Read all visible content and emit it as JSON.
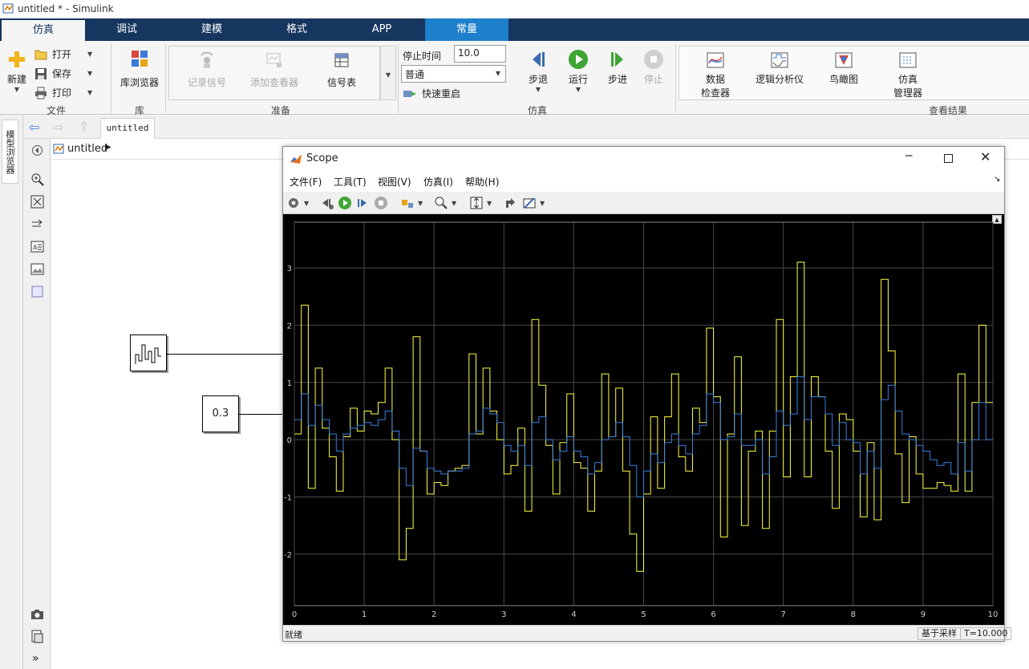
{
  "window": {
    "title": "untitled * - Simulink"
  },
  "tabs": [
    {
      "label": "仿真",
      "active": true
    },
    {
      "label": "调试"
    },
    {
      "label": "建模"
    },
    {
      "label": "格式"
    },
    {
      "label": "APP"
    },
    {
      "label": "常量",
      "contextual": true
    }
  ],
  "ribbon": {
    "file": {
      "new_label": "新建",
      "open_label": "打开",
      "save_label": "保存",
      "print_label": "打印",
      "group_label": "文件"
    },
    "library": {
      "browser_label": "库浏览器",
      "group_label": "库"
    },
    "prepare": {
      "record_label": "记录信号",
      "add_viewer_label": "添加查看器",
      "signal_table_label": "信号表",
      "group_label": "准备"
    },
    "simulate": {
      "stop_time_label": "停止时间",
      "stop_time_value": "10.0",
      "mode_value": "普通",
      "fast_restart_label": "快速重启",
      "step_back_label": "步退",
      "run_label": "运行",
      "step_forward_label": "步进",
      "stop_label": "停止",
      "group_label": "仿真"
    },
    "review": {
      "data_inspector_label_1": "数据",
      "data_inspector_label_2": "检查器",
      "logic_analyzer_label": "逻辑分析仪",
      "birdseye_label": "鸟瞰图",
      "sim_manager_label_1": "仿真",
      "sim_manager_label_2": "管理器",
      "group_label": "查看结果"
    }
  },
  "nav": {
    "model_tab": "untitled",
    "breadcrumb": "untitled",
    "side_tab": "模型浏览器"
  },
  "model": {
    "constant_value": "0.3"
  },
  "scope": {
    "title": "Scope",
    "menu": [
      "文件(F)",
      "工具(T)",
      "视图(V)",
      "仿真(I)",
      "帮助(H)"
    ],
    "status_left": "就绪",
    "status_mode": "基于采样",
    "status_time": "T=10.000"
  },
  "colors": {
    "tab_bar": "#16355f",
    "contextual_tab": "#1e7fcb",
    "trace_yellow": "#ffff40",
    "trace_blue": "#3a7fe0",
    "plot_bg": "#000000",
    "grid": "#4a4a4a"
  },
  "chart_data": {
    "type": "line",
    "xlim": [
      0,
      10
    ],
    "ylim": [
      -2.9,
      3.8
    ],
    "x_ticks": [
      "0",
      "1",
      "2",
      "3",
      "4",
      "5",
      "6",
      "7",
      "8",
      "9",
      "10"
    ],
    "y_ticks": [
      "-2",
      "-1",
      "0",
      "1",
      "2",
      "3"
    ],
    "grid": true,
    "step": true,
    "series": [
      {
        "color": "yellow",
        "x": [
          0,
          0.1,
          0.2,
          0.3,
          0.4,
          0.5,
          0.6,
          0.7,
          0.8,
          0.9,
          1.0,
          1.1,
          1.2,
          1.3,
          1.4,
          1.5,
          1.6,
          1.7,
          1.8,
          1.9,
          2.0,
          2.1,
          2.2,
          2.3,
          2.4,
          2.5,
          2.6,
          2.7,
          2.8,
          2.9,
          3.0,
          3.1,
          3.2,
          3.3,
          3.4,
          3.5,
          3.6,
          3.7,
          3.8,
          3.9,
          4.0,
          4.1,
          4.2,
          4.3,
          4.4,
          4.5,
          4.6,
          4.7,
          4.8,
          4.9,
          5.0,
          5.1,
          5.2,
          5.3,
          5.4,
          5.5,
          5.6,
          5.7,
          5.8,
          5.9,
          6.0,
          6.1,
          6.2,
          6.3,
          6.4,
          6.5,
          6.6,
          6.7,
          6.8,
          6.9,
          7.0,
          7.1,
          7.2,
          7.3,
          7.4,
          7.5,
          7.6,
          7.7,
          7.8,
          7.9,
          8.0,
          8.1,
          8.2,
          8.3,
          8.4,
          8.5,
          8.6,
          8.7,
          8.8,
          8.9,
          9.0,
          9.1,
          9.2,
          9.3,
          9.4,
          9.5,
          9.6,
          9.7,
          9.8,
          9.9
        ],
        "y": [
          0.1,
          2.35,
          -0.85,
          1.25,
          0.2,
          -0.3,
          -0.9,
          0.05,
          0.55,
          0.15,
          0.5,
          0.45,
          0.65,
          1.25,
          0.0,
          -2.1,
          -1.55,
          1.8,
          -0.2,
          -0.95,
          -0.75,
          -0.8,
          -0.55,
          -0.5,
          -0.45,
          1.5,
          0.1,
          1.25,
          0.5,
          0.0,
          -0.6,
          -0.45,
          0.2,
          -1.25,
          2.1,
          0.95,
          -0.1,
          -0.95,
          -0.05,
          0.8,
          -0.4,
          -0.5,
          -1.25,
          -0.55,
          1.15,
          0.05,
          0.9,
          -0.55,
          -1.65,
          -2.3,
          -0.95,
          0.4,
          -0.85,
          0.4,
          1.15,
          -0.3,
          -0.55,
          0.55,
          0.3,
          1.95,
          0.75,
          -1.7,
          0.1,
          1.45,
          -1.5,
          -0.2,
          0.15,
          -1.55,
          0.15,
          2.1,
          -0.65,
          1.1,
          3.1,
          -0.65,
          1.1,
          0.75,
          -0.2,
          -1.2,
          0.45,
          0.35,
          -0.2,
          -1.35,
          -0.05,
          -1.4,
          2.8,
          1.55,
          -0.25,
          -1.1,
          0.05,
          -0.6,
          -0.85,
          -0.85,
          -0.75,
          -0.8,
          -0.9,
          1.15,
          -0.9,
          0.65,
          2.0,
          0.65
        ]
      },
      {
        "color": "blue",
        "x": [
          0,
          0.1,
          0.2,
          0.3,
          0.4,
          0.5,
          0.6,
          0.7,
          0.8,
          0.9,
          1.0,
          1.1,
          1.2,
          1.3,
          1.4,
          1.5,
          1.6,
          1.7,
          1.8,
          1.9,
          2.0,
          2.1,
          2.2,
          2.3,
          2.4,
          2.5,
          2.6,
          2.7,
          2.8,
          2.9,
          3.0,
          3.1,
          3.2,
          3.3,
          3.4,
          3.5,
          3.6,
          3.7,
          3.8,
          3.9,
          4.0,
          4.1,
          4.2,
          4.3,
          4.4,
          4.5,
          4.6,
          4.7,
          4.8,
          4.9,
          5.0,
          5.1,
          5.2,
          5.3,
          5.4,
          5.5,
          5.6,
          5.7,
          5.8,
          5.9,
          6.0,
          6.1,
          6.2,
          6.3,
          6.4,
          6.5,
          6.6,
          6.7,
          6.8,
          6.9,
          7.0,
          7.1,
          7.2,
          7.3,
          7.4,
          7.5,
          7.6,
          7.7,
          7.8,
          7.9,
          8.0,
          8.1,
          8.2,
          8.3,
          8.4,
          8.5,
          8.6,
          8.7,
          8.8,
          8.9,
          9.0,
          9.1,
          9.2,
          9.3,
          9.4,
          9.5,
          9.6,
          9.7,
          9.8,
          9.9
        ],
        "y": [
          0.35,
          0.8,
          0.25,
          0.6,
          0.35,
          0.1,
          -0.2,
          0.1,
          0.2,
          0.25,
          0.3,
          0.25,
          0.35,
          0.5,
          0.15,
          -0.5,
          -0.8,
          -0.15,
          -0.2,
          -0.5,
          -0.55,
          -0.6,
          -0.55,
          -0.55,
          -0.5,
          0.1,
          0.15,
          0.55,
          0.45,
          0.3,
          -0.1,
          -0.2,
          -0.1,
          -0.45,
          0.3,
          0.4,
          0.0,
          -0.35,
          -0.2,
          0.05,
          -0.2,
          -0.3,
          -0.6,
          -0.4,
          0.0,
          0.05,
          0.3,
          0.05,
          -0.45,
          -1.0,
          -0.55,
          -0.25,
          -0.4,
          -0.05,
          0.1,
          -0.1,
          -0.25,
          0.1,
          0.25,
          0.8,
          0.65,
          0.0,
          0.05,
          0.45,
          -0.1,
          -0.1,
          0.0,
          -0.6,
          -0.3,
          0.5,
          0.25,
          0.45,
          1.1,
          0.35,
          0.75,
          0.75,
          0.45,
          -0.1,
          0.3,
          0.0,
          -0.05,
          -0.6,
          -0.2,
          -0.5,
          0.7,
          0.95,
          0.5,
          0.1,
          0.0,
          -0.1,
          -0.2,
          -0.35,
          -0.45,
          -0.4,
          -0.6,
          -0.05,
          -0.55,
          0.0,
          0.65,
          0.0
        ]
      }
    ]
  }
}
